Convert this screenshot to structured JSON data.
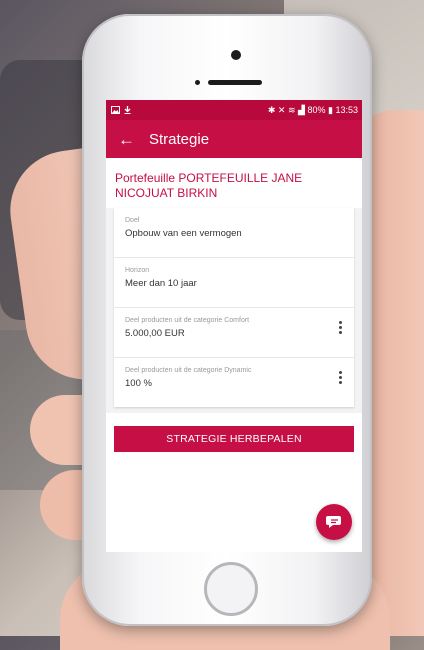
{
  "status_bar": {
    "left_icons": [
      "image-icon",
      "download-icon"
    ],
    "battery": "80%",
    "time": "13:53"
  },
  "app_bar": {
    "title": "Strategie"
  },
  "portfolio": {
    "title": "Portefeuille PORTEFEUILLE JANE NICOJUAT BIRKIN"
  },
  "items": [
    {
      "label": "Doel",
      "value": "Opbouw van een vermogen",
      "has_menu": false
    },
    {
      "label": "Horizon",
      "value": "Meer dan 10 jaar",
      "has_menu": false
    },
    {
      "label": "Deel producten uit de categorie Comfort",
      "value": "5.000,00 EUR",
      "has_menu": true
    },
    {
      "label": "Deel producten uit de categorie Dynamic",
      "value": "100 %",
      "has_menu": true
    }
  ],
  "cta": {
    "label": "STRATEGIE HERBEPALEN"
  },
  "fab": {
    "icon": "chat-icon"
  },
  "colors": {
    "brand": "#c50f45",
    "status_bar": "#b8093c"
  }
}
